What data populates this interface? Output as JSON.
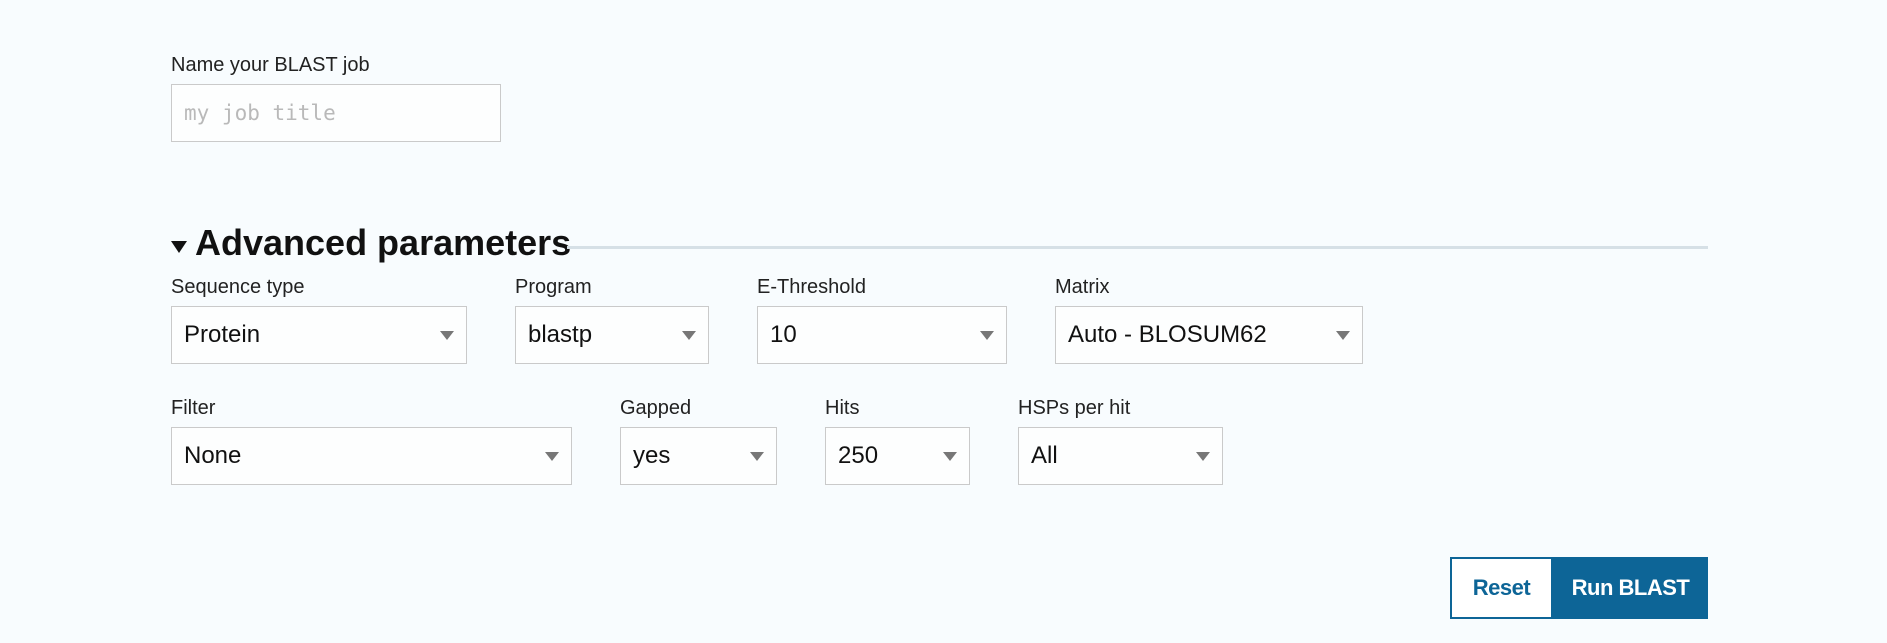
{
  "job": {
    "label": "Name your BLAST job",
    "placeholder": "my job title",
    "value": ""
  },
  "advanced": {
    "title": "Advanced parameters",
    "expanded": true
  },
  "params": {
    "sequence_type": {
      "label": "Sequence type",
      "value": "Protein"
    },
    "program": {
      "label": "Program",
      "value": "blastp"
    },
    "e_threshold": {
      "label": "E-Threshold",
      "value": "10"
    },
    "matrix": {
      "label": "Matrix",
      "value": "Auto - BLOSUM62"
    },
    "filter": {
      "label": "Filter",
      "value": "None"
    },
    "gapped": {
      "label": "Gapped",
      "value": "yes"
    },
    "hits": {
      "label": "Hits",
      "value": "250"
    },
    "hsps": {
      "label": "HSPs per hit",
      "value": "All"
    }
  },
  "buttons": {
    "reset": "Reset",
    "run": "Run BLAST"
  },
  "colors": {
    "accent": "#0d6597",
    "background": "#f8fcfe",
    "border": "#cacaca"
  }
}
